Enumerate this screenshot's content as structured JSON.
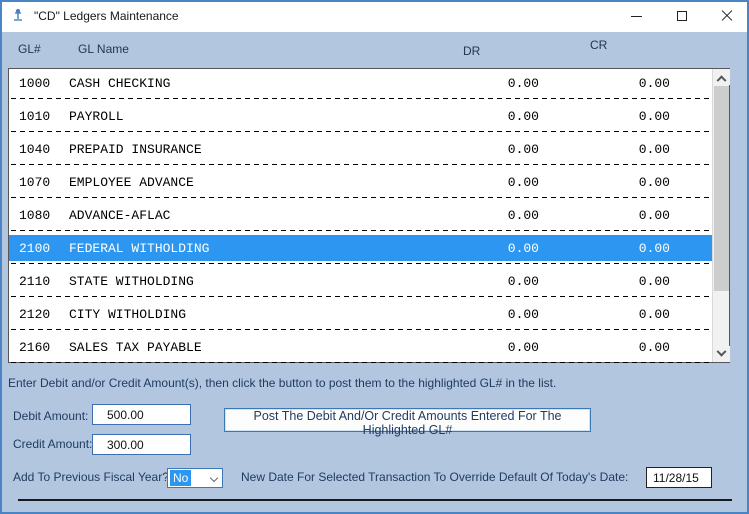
{
  "window": {
    "title": "\"CD\" Ledgers Maintenance"
  },
  "table": {
    "columns": [
      "GL#",
      "GL Name",
      "DR",
      "CR"
    ],
    "rows": [
      {
        "gl": "1000",
        "name": "CASH CHECKING",
        "dr": "0.00",
        "cr": "0.00",
        "selected": false
      },
      {
        "gl": "1010",
        "name": "PAYROLL",
        "dr": "0.00",
        "cr": "0.00",
        "selected": false
      },
      {
        "gl": "1040",
        "name": "PREPAID INSURANCE",
        "dr": "0.00",
        "cr": "0.00",
        "selected": false
      },
      {
        "gl": "1070",
        "name": "EMPLOYEE ADVANCE",
        "dr": "0.00",
        "cr": "0.00",
        "selected": false
      },
      {
        "gl": "1080",
        "name": "ADVANCE-AFLAC",
        "dr": "0.00",
        "cr": "0.00",
        "selected": false
      },
      {
        "gl": "2100",
        "name": "FEDERAL WITHOLDING",
        "dr": "0.00",
        "cr": "0.00",
        "selected": true
      },
      {
        "gl": "2110",
        "name": "STATE WITHOLDING",
        "dr": "0.00",
        "cr": "0.00",
        "selected": false
      },
      {
        "gl": "2120",
        "name": "CITY WITHOLDING",
        "dr": "0.00",
        "cr": "0.00",
        "selected": false
      },
      {
        "gl": "2160",
        "name": "SALES TAX PAYABLE",
        "dr": "0.00",
        "cr": "0.00",
        "selected": false
      }
    ]
  },
  "instruction": "Enter Debit and/or Credit Amount(s), then click the button to post them to the highlighted GL# in the list.",
  "form": {
    "debit_label": "Debit Amount:",
    "debit_value": "500.00",
    "credit_label": "Credit Amount:",
    "credit_value": "300.00",
    "post_button": "Post The Debit And/Or Credit Amounts Entered For The Highlighted GL#",
    "fiscal_label": "Add To Previous Fiscal Year?",
    "fiscal_value": "No",
    "date_label": "New Date For Selected Transaction To Override Default Of Today's Date:",
    "date_value": "11/28/15"
  },
  "colors": {
    "frame": "#4b84c4",
    "background": "#b2c6e0",
    "selection": "#2d96f0",
    "label_text": "#1e3a5f"
  }
}
